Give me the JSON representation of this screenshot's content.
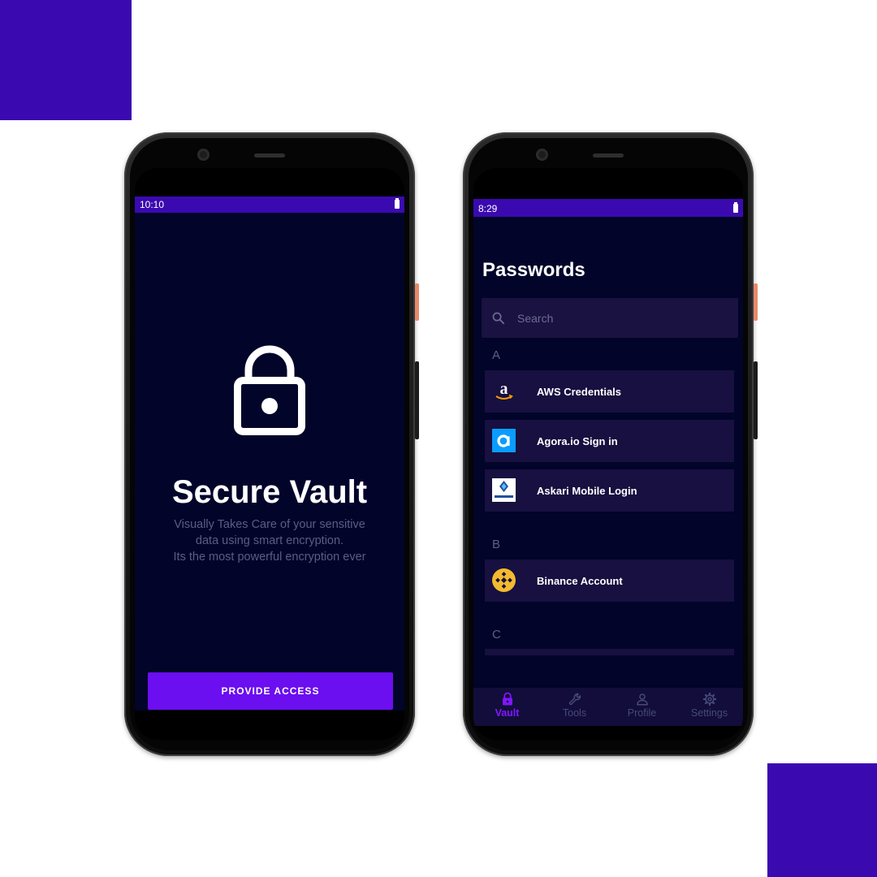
{
  "colors": {
    "brand": "#3a0ab0",
    "accent": "#6b0ef0",
    "screen_bg": "#02042a",
    "card_bg": "#171040"
  },
  "phone1": {
    "status_time": "10:10",
    "lock_icon": "padlock-icon",
    "title": "Secure Vault",
    "subtitle_lines": [
      "Visually Takes Care of your sensitive",
      "data using smart encryption.",
      "Its the most powerful encryption ever"
    ],
    "cta_label": "PROVIDE ACCESS"
  },
  "phone2": {
    "status_time": "8:29",
    "title": "Passwords",
    "search": {
      "placeholder": "Search",
      "value": "",
      "icon": "search-icon"
    },
    "sections": [
      {
        "letter": "A",
        "items": [
          {
            "label": "AWS Credentials",
            "icon": "amazon-logo-icon"
          },
          {
            "label": "Agora.io Sign in",
            "icon": "agora-logo-icon"
          },
          {
            "label": "Askari Mobile Login",
            "icon": "askari-bank-logo-icon"
          }
        ]
      },
      {
        "letter": "B",
        "items": [
          {
            "label": "Binance Account",
            "icon": "binance-logo-icon"
          }
        ]
      },
      {
        "letter": "C",
        "items": []
      }
    ],
    "nav": [
      {
        "label": "Vault",
        "icon": "lock-icon",
        "active": true
      },
      {
        "label": "Tools",
        "icon": "wrench-icon",
        "active": false
      },
      {
        "label": "Profile",
        "icon": "person-icon",
        "active": false
      },
      {
        "label": "Settings",
        "icon": "gear-icon",
        "active": false
      }
    ]
  }
}
